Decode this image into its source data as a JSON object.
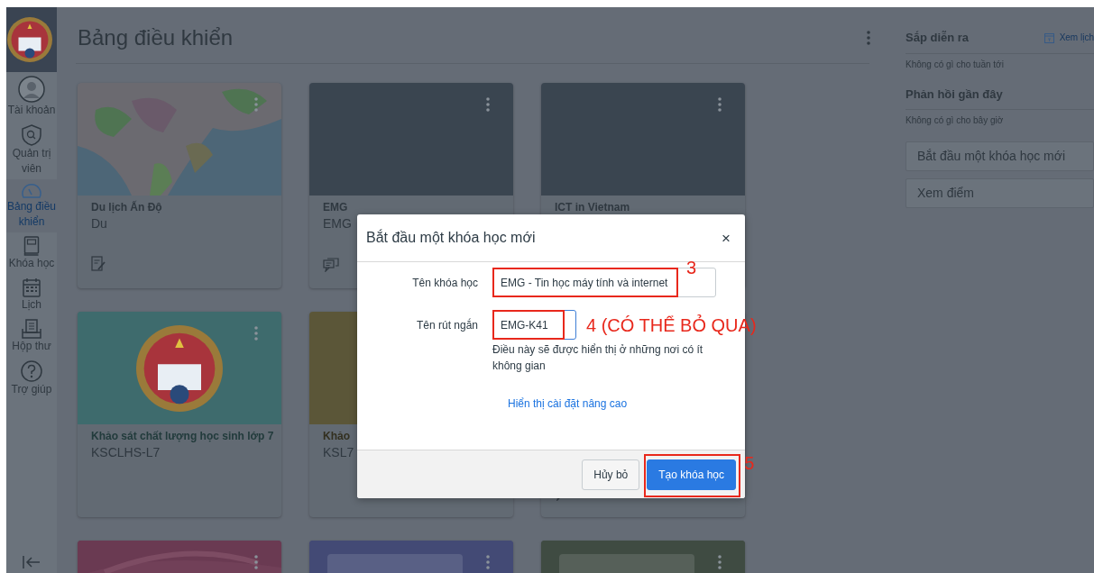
{
  "sidebar": {
    "items": [
      {
        "kind": "avatar",
        "label": "Tài khoản",
        "selected": false
      },
      {
        "kind": "shield",
        "label": "Quản trị viên",
        "selected": false
      },
      {
        "kind": "gauge",
        "label": "Bảng điều khiển",
        "selected": true
      },
      {
        "kind": "book",
        "label": "Khóa học",
        "selected": false
      },
      {
        "kind": "calendar",
        "label": "Lịch",
        "selected": false
      },
      {
        "kind": "inbox",
        "label": "Hộp thư",
        "selected": false
      },
      {
        "kind": "help",
        "label": "Trợ giúp",
        "selected": false
      }
    ]
  },
  "dashboard": {
    "title": "Bảng điều khiển",
    "cards": [
      {
        "kind": "map",
        "title": "Du lịch Ấn Độ",
        "code": "Du"
      },
      {
        "kind": "plain",
        "color": "#3a4550",
        "title": "EMG",
        "code": "EMG"
      },
      {
        "kind": "plain",
        "color": "#3a4550",
        "title": "ICT in Vietnam"
      },
      {
        "kind": "emblem",
        "color": "#3e6b6d",
        "title": "Khảo sát chất lượng học sinh lớp 7",
        "code": "KSCLHS-L7"
      },
      {
        "kind": "plain",
        "color": "#5b5638",
        "title": "Khảo",
        "code": "KSL7"
      },
      {
        "kind": "hidden"
      },
      {
        "kind": "waves",
        "color": "#6a3a52"
      },
      {
        "kind": "banner",
        "color": "#434a75"
      },
      {
        "kind": "banner",
        "color": "#3f4b42"
      }
    ]
  },
  "right_panel": {
    "upcoming": {
      "title": "Sắp diễn ra",
      "link": "Xem lịch",
      "empty": "Không có gì cho tuần tới"
    },
    "feedback": {
      "title": "Phản hồi gần đây",
      "empty": "Không có gì cho bây giờ"
    },
    "buttons": [
      "Bắt đầu một khóa học mới",
      "Xem điểm"
    ]
  },
  "modal": {
    "title": "Bắt đầu một khóa học mới",
    "close": "×",
    "fields": [
      {
        "label": "Tên khóa học",
        "value": "EMG - Tin học máy tính và internet",
        "focused": false,
        "annotation": "3"
      },
      {
        "label": "Tên rút ngắn",
        "value": "EMG-K41",
        "focused": true,
        "annotation": "4 (CÓ THỂ BỎ QUA)",
        "hint": "Điều này sẽ được hiển thị ở những nơi có ít không gian"
      }
    ],
    "link": "Hiển thị cài đặt nâng cao",
    "cancel": "Hủy bỏ",
    "submit": {
      "label": "Tạo khóa học",
      "annotation": "5"
    }
  }
}
